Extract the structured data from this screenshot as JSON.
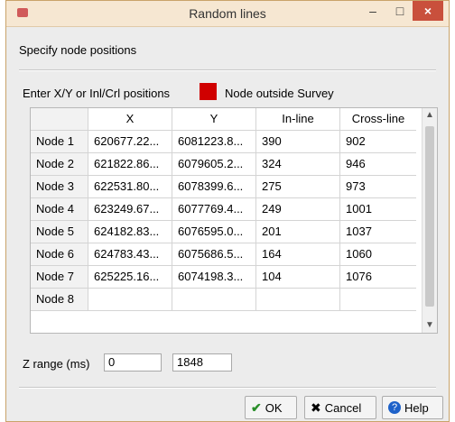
{
  "window": {
    "title": "Random lines",
    "minimize": "–",
    "maximize": "□",
    "close": "×"
  },
  "labels": {
    "specify": "Specify node positions",
    "enter": "Enter X/Y or Inl/Crl positions",
    "outside": "Node outside Survey",
    "z_range": "Z range (ms)"
  },
  "colors": {
    "outside_swatch": "#d00000",
    "close_button": "#c9503c"
  },
  "table": {
    "headers": [
      "",
      "X",
      "Y",
      "In-line",
      "Cross-line"
    ],
    "rows": [
      [
        "Node 1",
        "620677.22...",
        "6081223.8...",
        "390",
        "902"
      ],
      [
        "Node 2",
        "621822.86...",
        "6079605.2...",
        "324",
        "946"
      ],
      [
        "Node 3",
        "622531.80...",
        "6078399.6...",
        "275",
        "973"
      ],
      [
        "Node 4",
        "623249.67...",
        "6077769.4...",
        "249",
        "1001"
      ],
      [
        "Node 5",
        "624182.83...",
        "6076595.0...",
        "201",
        "1037"
      ],
      [
        "Node 6",
        "624783.43...",
        "6075686.5...",
        "164",
        "1060"
      ],
      [
        "Node 7",
        "625225.16...",
        "6074198.3...",
        "104",
        "1076"
      ],
      [
        "Node 8",
        "",
        "",
        "",
        ""
      ]
    ]
  },
  "z_range": {
    "from": "0",
    "to": "1848"
  },
  "buttons": {
    "ok": "OK",
    "cancel": "Cancel",
    "help": "Help"
  },
  "icons": {
    "app": "app-icon",
    "ok": "checkmark-icon",
    "cancel": "cancel-icon",
    "help": "help-icon"
  }
}
